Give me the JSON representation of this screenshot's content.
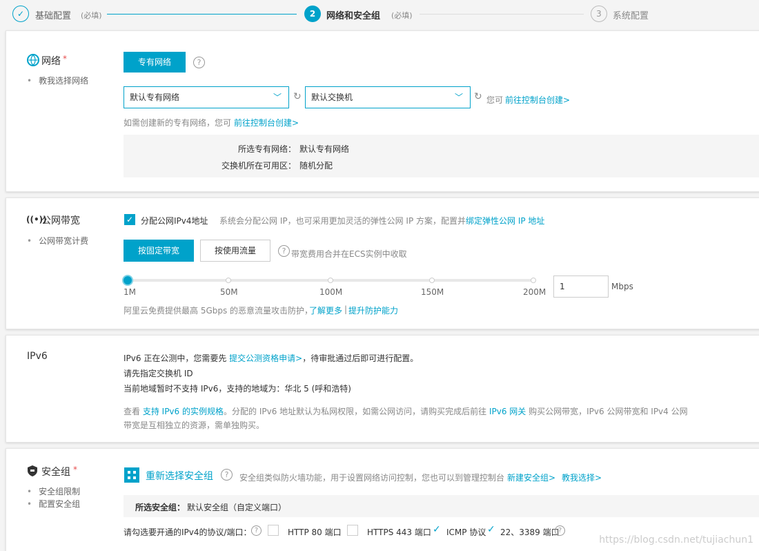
{
  "steps": [
    {
      "num": "✓",
      "label": "基础配置",
      "note": "(必填)"
    },
    {
      "num": "2",
      "label": "网络和安全组",
      "note": "(必填)"
    },
    {
      "num": "3",
      "label": "系统配置",
      "note": ""
    }
  ],
  "network": {
    "title": "网络",
    "required": "*",
    "help": "教我选择网络",
    "vpc_button": "专有网络",
    "vpc_select": "默认专有网络",
    "vswitch_select": "默认交换机",
    "console_prefix": "您可",
    "console_link": "前往控制台创建>",
    "create_hint": "如需创建新的专有网络，您可",
    "create_link": "前往控制台创建>",
    "summary_vpc_label": "所选专有网络：",
    "summary_vpc_value": "默认专有网络",
    "summary_zone_label": "交换机所在可用区：",
    "summary_zone_value": "随机分配"
  },
  "bandwidth": {
    "title": "公网带宽",
    "help": "公网带宽计费",
    "assign_label": "分配公网IPv4地址",
    "assign_desc": "系统会分配公网 IP，也可采用更加灵活的弹性公网 IP 方案，配置并",
    "assign_link": "绑定弹性公网 IP 地址",
    "fixed_button": "按固定带宽",
    "traffic_button": "按使用流量",
    "fee_note": "带宽费用合并在ECS实例中收取",
    "ticks": [
      "1M",
      "50M",
      "100M",
      "150M",
      "200M"
    ],
    "value": "1",
    "unit": "Mbps",
    "slider_min": 1,
    "slider_max": 200,
    "slider_value": 1,
    "ddos_text": "阿里云免费提供最高 5Gbps 的恶意流量攻击防护，",
    "ddos_link1": "了解更多",
    "ddos_sep": "|",
    "ddos_link2": "提升防护能力"
  },
  "ipv6": {
    "title": "IPv6",
    "line1_prefix": "IPv6 正在公测中，您需要先",
    "line1_link": "提交公测资格申请>",
    "line1_suffix": "，待审批通过后即可进行配置。",
    "line2": "请先指定交换机 ID",
    "line3": "当前地域暂时不支持 IPv6，支持的地域为：华北 5 (呼和浩特)",
    "para_prefix": "查看",
    "para_link1": "支持 IPv6 的实例规格",
    "para_mid": "。分配的 IPv6 地址默认为私网权限，如需公网访问，请购买完成后前往",
    "para_link2": "IPv6 网关",
    "para_suffix": "购买公网带宽，IPv6 公网带宽和 IPv4 公网",
    "para_line2": "带宽是互相独立的资源，需单独购买。"
  },
  "security": {
    "title": "安全组",
    "required": "*",
    "help1": "安全组限制",
    "help2": "配置安全组",
    "reselect": "重新选择安全组",
    "desc": "安全组类似防火墙功能，用于设置网络访问控制，您也可以到管理控制台",
    "new_link": "新建安全组>",
    "teach_link": "教我选择>",
    "selected_label": "所选安全组：",
    "selected_value": "默认安全组（自定义端口）",
    "ports_label": "请勾选要开通的IPv4的协议/端口：",
    "ports": [
      {
        "label": "HTTP 80 端口",
        "checked": false
      },
      {
        "label": "HTTPS 443 端口",
        "checked": false
      },
      {
        "label": "ICMP 协议",
        "checked": true
      },
      {
        "label": "22、3389 端口",
        "checked": true
      }
    ]
  },
  "watermark": "https://blog.csdn.net/tujiachun1",
  "colors": {
    "accent": "#00a2ca",
    "required": "#e64d4d"
  }
}
